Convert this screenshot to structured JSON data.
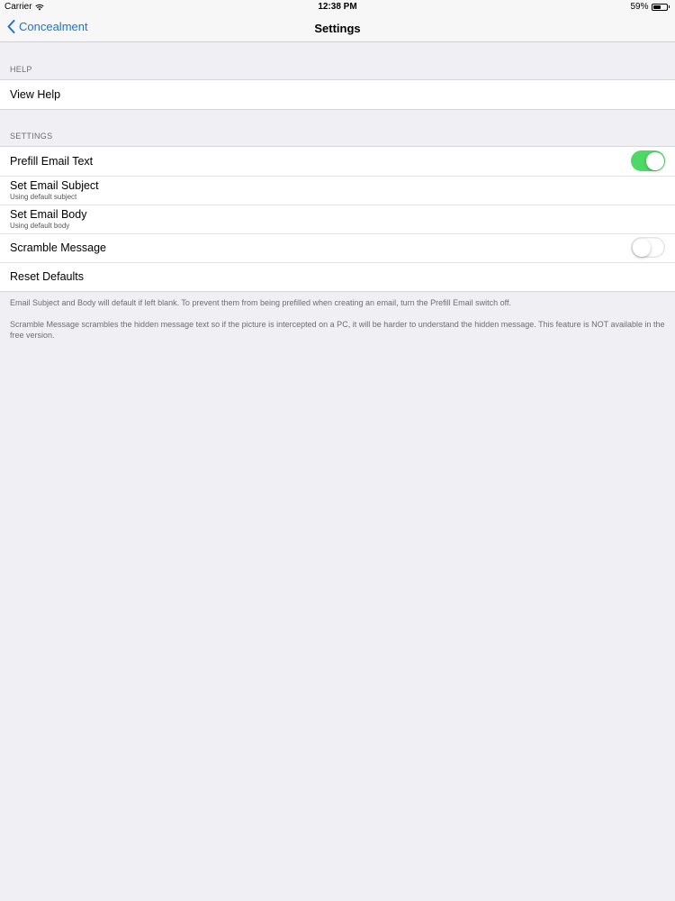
{
  "status_bar": {
    "carrier": "Carrier",
    "time": "12:38 PM",
    "battery": "59%",
    "battery_level": 0.59
  },
  "nav": {
    "back_label": "Concealment",
    "title": "Settings"
  },
  "sections": {
    "help_header": "HELP",
    "help_view": "View Help",
    "settings_header": "SETTINGS",
    "prefill": {
      "label": "Prefill Email Text",
      "on": true
    },
    "subject": {
      "label": "Set Email Subject",
      "sub": "Using default subject"
    },
    "body": {
      "label": "Set Email Body",
      "sub": "Using default body"
    },
    "scramble": {
      "label": "Scramble Message",
      "on": false
    },
    "reset": "Reset Defaults"
  },
  "footer": {
    "note1": "Email Subject and Body will default if left blank. To prevent them from being prefilled when creating an email, turn the Prefill Email switch off.",
    "note2": "Scramble Message scrambles the hidden message text so if the picture is intercepted on a PC, it will be harder to understand the hidden message. This feature is NOT available in the free version."
  },
  "colors": {
    "accent": "#1a73d9",
    "switch_on": "#4cd964",
    "background": "#efeff4"
  }
}
